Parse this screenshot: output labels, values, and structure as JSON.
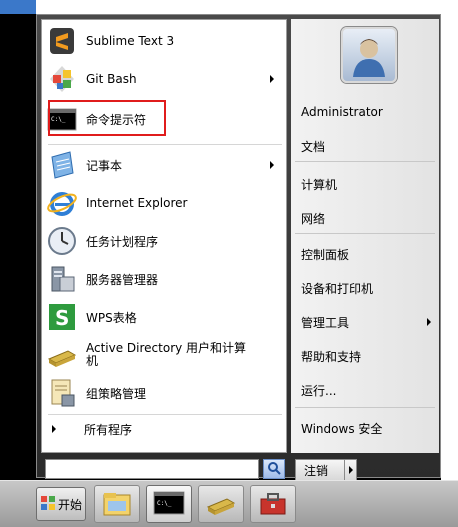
{
  "colors": {
    "highlight_border": "#e01c1c",
    "start_orb": "#2f7fd6"
  },
  "left_items": [
    {
      "label": "Sublime Text 3",
      "icon": "sublime-text-icon",
      "submenu": false
    },
    {
      "label": "Git Bash",
      "icon": "git-bash-icon",
      "submenu": true
    },
    {
      "label": "命令提示符",
      "icon": "command-prompt-icon",
      "submenu": false,
      "highlighted": true
    },
    {
      "label": "记事本",
      "icon": "notepad-icon",
      "submenu": true
    },
    {
      "label": "Internet Explorer",
      "icon": "internet-explorer-icon",
      "submenu": false
    },
    {
      "label": "任务计划程序",
      "icon": "task-scheduler-icon",
      "submenu": false
    },
    {
      "label": "服务器管理器",
      "icon": "server-manager-icon",
      "submenu": false
    },
    {
      "label": "WPS表格",
      "icon": "wps-spreadsheet-icon",
      "submenu": false
    },
    {
      "label": "Active Directory 用户和计算机",
      "icon": "active-directory-icon",
      "submenu": false
    },
    {
      "label": "组策略管理",
      "icon": "group-policy-icon",
      "submenu": false
    }
  ],
  "all_programs": "所有程序",
  "search": {
    "value": "",
    "placeholder": ""
  },
  "right_items": [
    {
      "label": "Administrator",
      "submenu": false
    },
    {
      "label": "文档",
      "submenu": false
    },
    {
      "label": "计算机",
      "submenu": false
    },
    {
      "label": "网络",
      "submenu": false
    },
    {
      "label": "控制面板",
      "submenu": false
    },
    {
      "label": "设备和打印机",
      "submenu": false
    },
    {
      "label": "管理工具",
      "submenu": true
    },
    {
      "label": "帮助和支持",
      "submenu": false
    },
    {
      "label": "运行...",
      "submenu": false
    },
    {
      "label": "Windows 安全",
      "submenu": false
    }
  ],
  "shutdown": {
    "label": "注销"
  },
  "taskbar": {
    "start_label": "开始",
    "pinned": [
      "explorer-icon",
      "command-prompt-icon",
      "active-directory-icon",
      "toolbox-icon"
    ]
  }
}
